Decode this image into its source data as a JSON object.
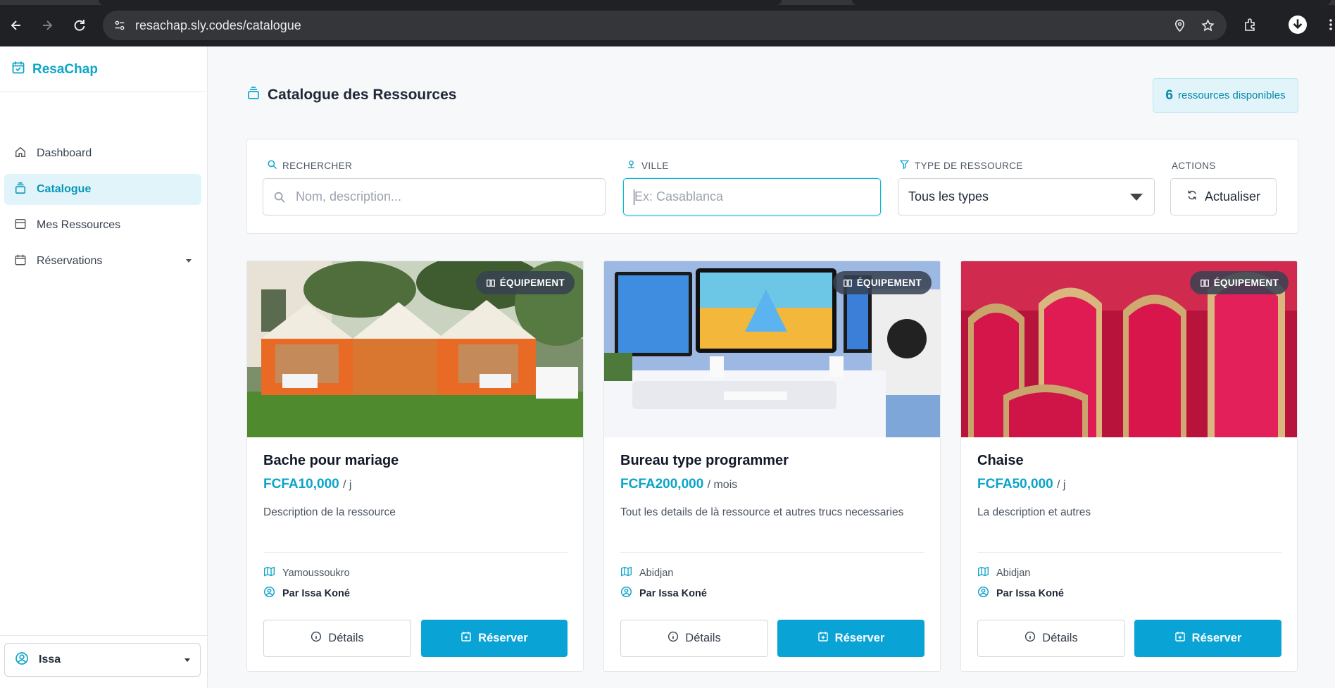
{
  "browser": {
    "url": "resachap.sly.codes/catalogue"
  },
  "sidebar": {
    "brand": "ResaChap",
    "items": [
      {
        "label": "Dashboard",
        "icon": "home-icon"
      },
      {
        "label": "Catalogue",
        "icon": "catalogue-icon",
        "active": true
      },
      {
        "label": "Mes Ressources",
        "icon": "box-icon"
      },
      {
        "label": "Réservations",
        "icon": "calendar-icon",
        "expandable": true
      }
    ],
    "user": "Issa"
  },
  "header": {
    "title": "Catalogue des Ressources",
    "count": "6",
    "count_label": "ressources disponibles"
  },
  "filters": {
    "search_label": "RECHERCHER",
    "search_placeholder": "Nom, description...",
    "search_value": "",
    "city_label": "VILLE",
    "city_placeholder": "Ex: Casablanca",
    "city_value": "",
    "type_label": "TYPE DE RESSOURCE",
    "type_value": "Tous les types",
    "actions_label": "ACTIONS",
    "refresh_label": "Actualiser"
  },
  "cards": [
    {
      "badge": "ÉQUIPEMENT",
      "title": "Bache pour mariage",
      "price": "FCFA10,000",
      "unit": "/ j",
      "description": "Description de la ressource",
      "city": "Yamoussoukro",
      "owner": "Par Issa Koné",
      "details_label": "Détails",
      "reserve_label": "Réserver"
    },
    {
      "badge": "ÉQUIPEMENT",
      "title": "Bureau type programmer",
      "price": "FCFA200,000",
      "unit": "/ mois",
      "description": "Tout les details de là ressource et autres trucs necessaries",
      "city": "Abidjan",
      "owner": "Par Issa Koné",
      "details_label": "Détails",
      "reserve_label": "Réserver"
    },
    {
      "badge": "ÉQUIPEMENT",
      "title": "Chaise",
      "price": "FCFA50,000",
      "unit": "/ j",
      "description": "La description et autres",
      "city": "Abidjan",
      "owner": "Par Issa Koné",
      "details_label": "Détails",
      "reserve_label": "Réserver"
    }
  ],
  "colors": {
    "accent": "#0aa3d6",
    "brand": "#0ea5c9",
    "active_bg": "#e0f4fa"
  }
}
